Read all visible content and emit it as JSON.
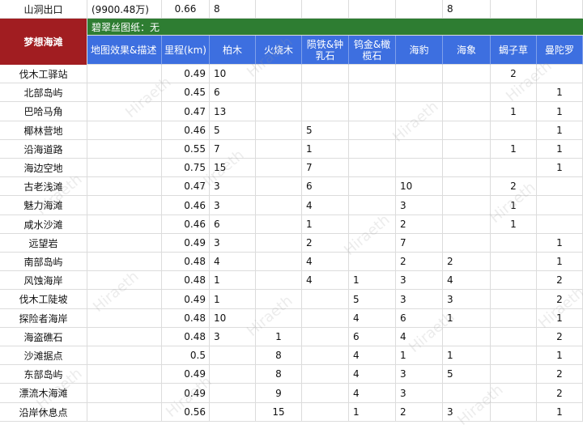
{
  "top_row": {
    "name": "山洞出口",
    "price": "(9900.48万)",
    "distance": "0.66",
    "v1": "8",
    "v2": "8"
  },
  "region_label": "梦想海滩",
  "banner": "碧翠丝图纸：无",
  "headers": [
    "地图效果&描述",
    "里程(km)",
    "柏木",
    "火烧木",
    "陨铁&钟乳石",
    "钨金&橄榄石",
    "海豹",
    "海象",
    "蝎子草",
    "曼陀罗"
  ],
  "rows": [
    {
      "name": "伐木工驿站",
      "km": "0.49",
      "vals": [
        "10",
        "",
        "",
        "",
        "",
        "",
        "2",
        ""
      ]
    },
    {
      "name": "北部岛屿",
      "km": "0.45",
      "vals": [
        "6",
        "",
        "",
        "",
        "",
        "",
        "",
        "1"
      ]
    },
    {
      "name": "巴哈马角",
      "km": "0.47",
      "vals": [
        "13",
        "",
        "",
        "",
        "",
        "",
        "1",
        "1"
      ]
    },
    {
      "name": "椰林营地",
      "km": "0.46",
      "vals": [
        "5",
        "",
        "5",
        "",
        "",
        "",
        "",
        "1"
      ]
    },
    {
      "name": "沿海道路",
      "km": "0.55",
      "vals": [
        "7",
        "",
        "1",
        "",
        "",
        "",
        "1",
        "1"
      ]
    },
    {
      "name": "海边空地",
      "km": "0.75",
      "vals": [
        "15",
        "",
        "7",
        "",
        "",
        "",
        "",
        "1"
      ]
    },
    {
      "name": "古老浅滩",
      "km": "0.47",
      "vals": [
        "3",
        "",
        "6",
        "",
        "10",
        "",
        "2",
        ""
      ]
    },
    {
      "name": "魅力海滩",
      "km": "0.46",
      "vals": [
        "3",
        "",
        "4",
        "",
        "3",
        "",
        "1",
        ""
      ]
    },
    {
      "name": "咸水沙滩",
      "km": "0.46",
      "vals": [
        "6",
        "",
        "1",
        "",
        "2",
        "",
        "1",
        ""
      ]
    },
    {
      "name": "远望岩",
      "km": "0.49",
      "vals": [
        "3",
        "",
        "2",
        "",
        "7",
        "",
        "",
        "1"
      ]
    },
    {
      "name": "南部岛屿",
      "km": "0.48",
      "vals": [
        "4",
        "",
        "4",
        "",
        "2",
        "2",
        "",
        "1"
      ]
    },
    {
      "name": "风蚀海岸",
      "km": "0.48",
      "vals": [
        "1",
        "",
        "4",
        "1",
        "3",
        "4",
        "",
        "2"
      ]
    },
    {
      "name": "伐木工陡坡",
      "km": "0.49",
      "vals": [
        "1",
        "",
        "",
        "5",
        "3",
        "3",
        "",
        "2"
      ]
    },
    {
      "name": "探险者海岸",
      "km": "0.48",
      "vals": [
        "10",
        "",
        "",
        "4",
        "6",
        "1",
        "",
        "1"
      ]
    },
    {
      "name": "海盗礁石",
      "km": "0.48",
      "vals": [
        "3",
        "1",
        "",
        "6",
        "4",
        "",
        "",
        "2"
      ]
    },
    {
      "name": "沙滩据点",
      "km": "0.5",
      "vals": [
        "",
        "8",
        "",
        "4",
        "1",
        "1",
        "",
        "1"
      ]
    },
    {
      "name": "东部岛屿",
      "km": "0.49",
      "vals": [
        "",
        "8",
        "",
        "4",
        "3",
        "5",
        "",
        "2"
      ]
    },
    {
      "name": "漂流木海滩",
      "km": "0.49",
      "vals": [
        "",
        "9",
        "",
        "4",
        "3",
        "",
        "",
        "2"
      ]
    },
    {
      "name": "沿岸休息点",
      "km": "0.56",
      "vals": [
        "",
        "15",
        "",
        "1",
        "2",
        "3",
        "",
        "1"
      ]
    }
  ],
  "watermark": "Hiraeth",
  "colors": {
    "region": "#a11d21",
    "banner": "#2e7d32",
    "header": "#3d6fe0"
  }
}
